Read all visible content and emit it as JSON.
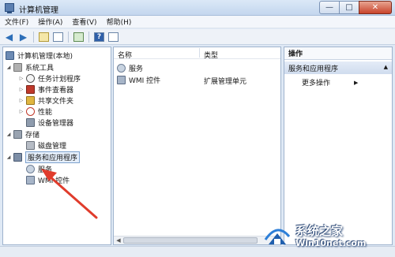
{
  "window": {
    "title": "计算机管理"
  },
  "menu": [
    "文件(F)",
    "操作(A)",
    "查看(V)",
    "帮助(H)"
  ],
  "tree": {
    "root": "计算机管理(本地)",
    "system_tools": "系统工具",
    "task_scheduler": "任务计划程序",
    "event_viewer": "事件查看器",
    "shared_folders": "共享文件夹",
    "performance": "性能",
    "device_manager": "设备管理器",
    "storage": "存储",
    "disk_management": "磁盘管理",
    "services_apps": "服务和应用程序",
    "services": "服务",
    "wmi": "WMI 控件"
  },
  "list": {
    "headers": {
      "name": "名称",
      "type": "类型"
    },
    "rows": [
      {
        "name": "服务",
        "type": ""
      },
      {
        "name": "WMI 控件",
        "type": "扩展管理单元"
      }
    ]
  },
  "actions": {
    "title": "操作",
    "section": "服务和应用程序",
    "more": "更多操作"
  },
  "watermark": {
    "line1": "系统之家",
    "line2": "Win10net.com"
  },
  "colors": {
    "annotation_arrow": "#e03c2c"
  }
}
